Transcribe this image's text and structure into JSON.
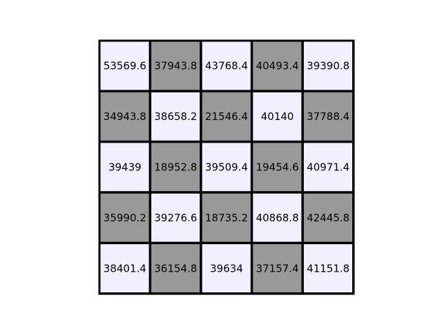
{
  "chart_data": {
    "type": "table",
    "rows": [
      [
        "53569.6",
        "37943.8",
        "43768.4",
        "40493.4",
        "39390.8"
      ],
      [
        "34943.8",
        "38658.2",
        "21546.4",
        "40140",
        "37788.4"
      ],
      [
        "39439",
        "18952.8",
        "39509.4",
        "19454.6",
        "40971.4"
      ],
      [
        "35990.2",
        "39276.6",
        "18735.2",
        "40868.8",
        "42445.8"
      ],
      [
        "38401.4",
        "36154.8",
        "39634",
        "37157.4",
        "41151.8"
      ]
    ],
    "pattern": "checkerboard",
    "colors": {
      "light": "#f0f0ff",
      "dark": "#999999",
      "border": "#000000",
      "background": "#ffffff"
    }
  }
}
